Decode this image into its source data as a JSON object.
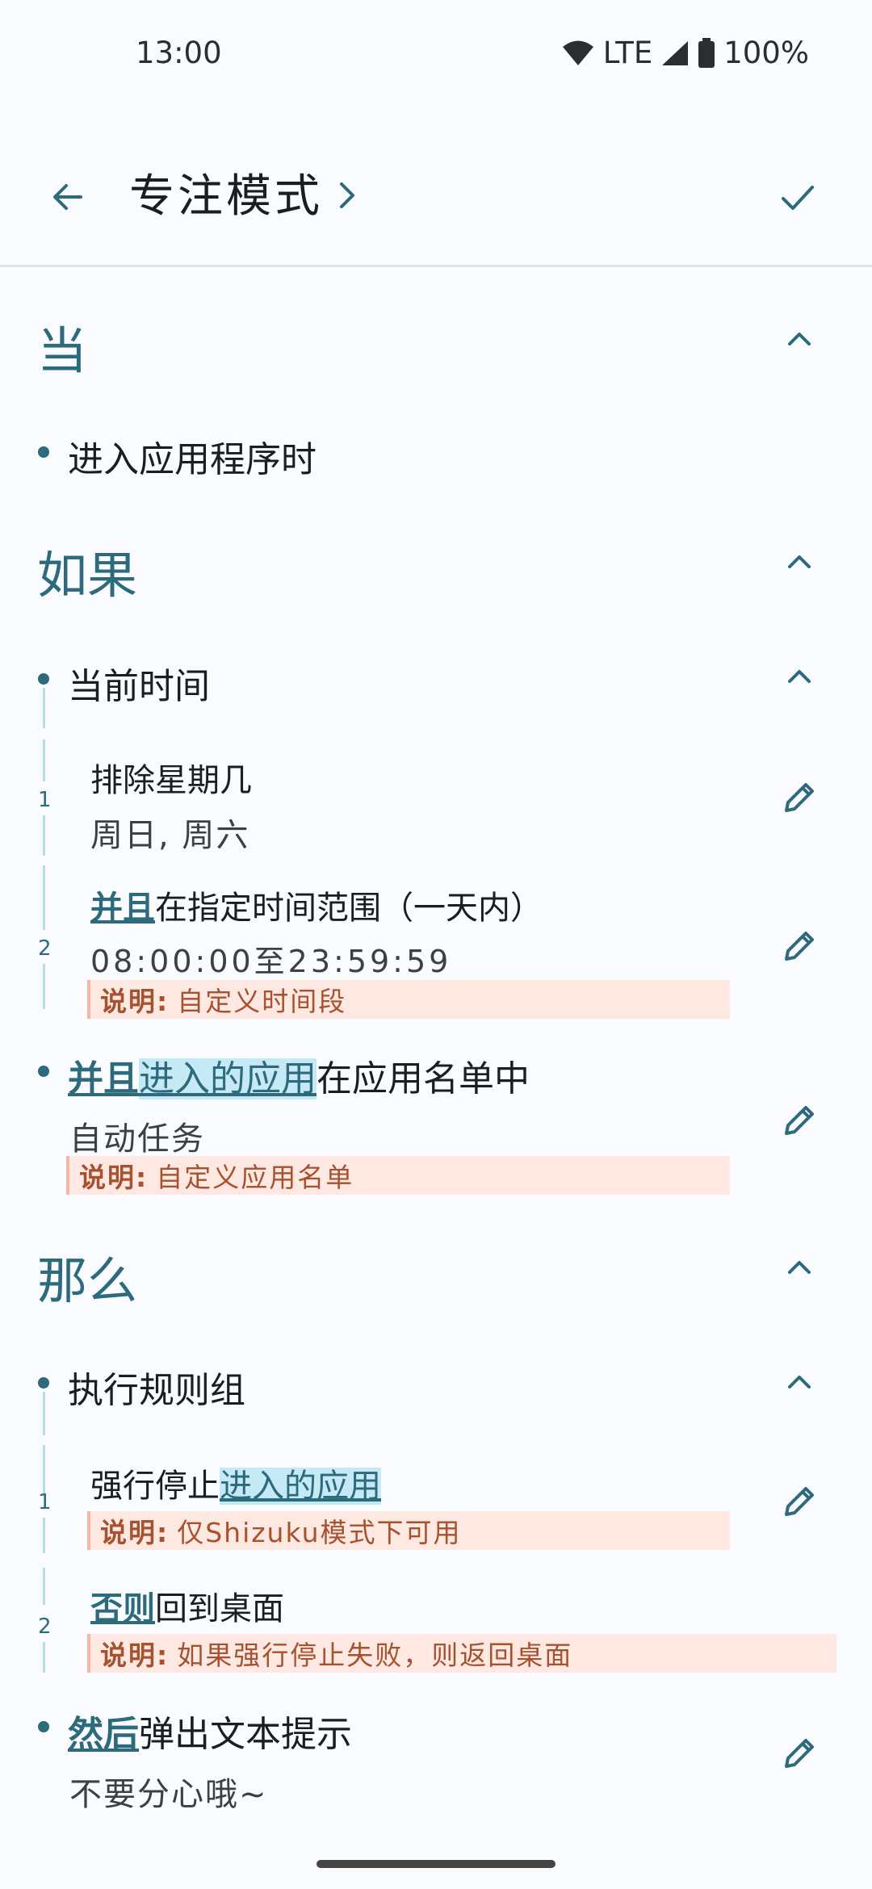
{
  "status": {
    "time": "13:00",
    "network": "LTE",
    "battery": "100%"
  },
  "appbar": {
    "title": "专注模式"
  },
  "sections": {
    "when": {
      "title": "当",
      "item": "进入应用程序时"
    },
    "if": {
      "title": "如果",
      "group": "当前时间",
      "sub1": {
        "num": "1",
        "title": "排除星期几",
        "value": "周日, 周六"
      },
      "sub2": {
        "num": "2",
        "kw": "并且",
        "title": "在指定时间范围（一天内）",
        "value": "08:00:00至23:59:59",
        "note_label": "说明:",
        "note": "自定义时间段"
      },
      "item2": {
        "kw": "并且",
        "hl": "进入的应用",
        "title": "在应用名单中",
        "value": "自动任务",
        "note_label": "说明:",
        "note": "自定义应用名单"
      }
    },
    "then": {
      "title": "那么",
      "group": "执行规则组",
      "sub1": {
        "num": "1",
        "prefix": "强行停止",
        "hl": "进入的应用",
        "note_label": "说明:",
        "note": "仅Shizuku模式下可用"
      },
      "sub2": {
        "num": "2",
        "kw": "否则",
        "title": "回到桌面",
        "note_label": "说明:",
        "note": "如果强行停止失败，则返回桌面"
      },
      "item2": {
        "kw": "然后",
        "title": "弹出文本提示",
        "value": "不要分心哦~"
      }
    }
  }
}
